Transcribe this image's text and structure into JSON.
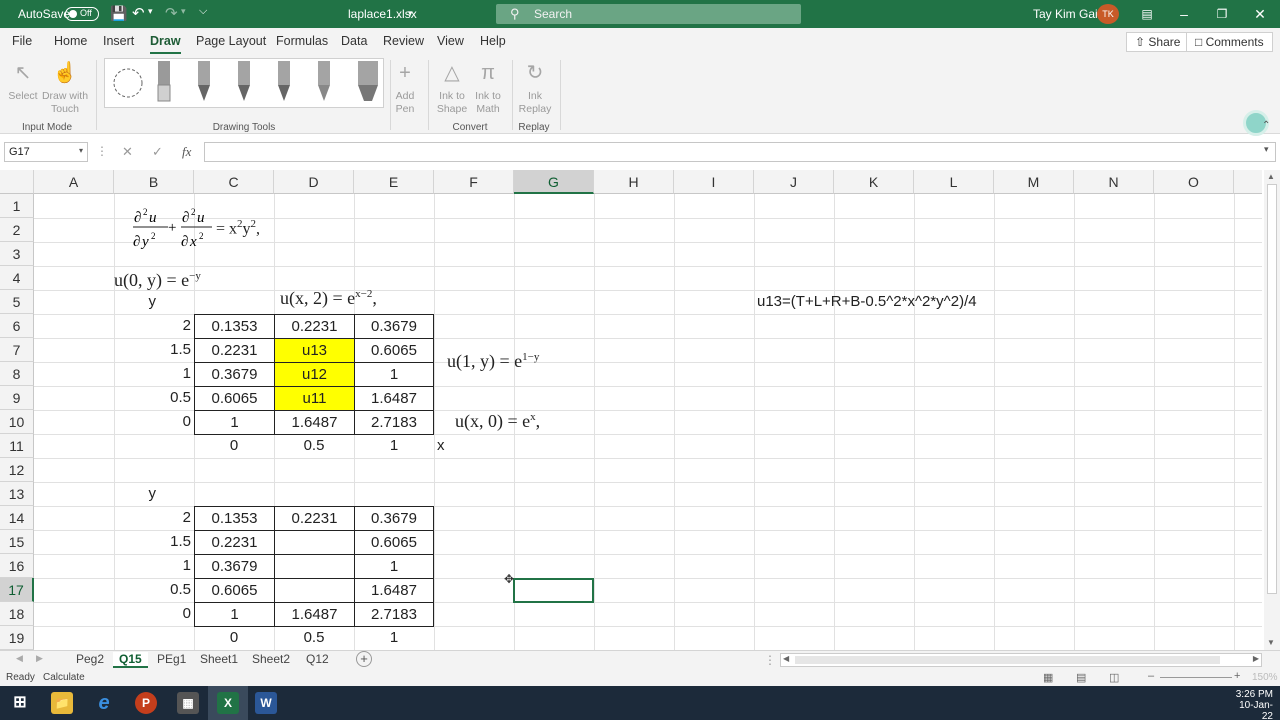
{
  "titlebar": {
    "autosave_label": "AutoSave",
    "autosave_state": "Off",
    "filename": "laplace1.xlsx",
    "search_placeholder": "Search",
    "user_name": "Tay Kim Gaik",
    "user_initials": "TK"
  },
  "tabs": [
    "File",
    "Home",
    "Insert",
    "Draw",
    "Page Layout",
    "Formulas",
    "Data",
    "Review",
    "View",
    "Help"
  ],
  "active_tab": "Draw",
  "share_label": "Share",
  "comments_label": "Comments",
  "ribbon": {
    "select_label": "Select",
    "draw_touch_label_1": "Draw with",
    "draw_touch_label_2": "Touch",
    "input_mode_label": "Input Mode",
    "drawing_tools_label": "Drawing Tools",
    "add_pen_label_1": "Add",
    "add_pen_label_2": "Pen",
    "ink_shape_label_1": "Ink to",
    "ink_shape_label_2": "Shape",
    "ink_math_label_1": "Ink to",
    "ink_math_label_2": "Math",
    "ink_replay_label_1": "Ink",
    "ink_replay_label_2": "Replay",
    "convert_label": "Convert",
    "replay_label": "Replay"
  },
  "namebox": "G17",
  "formula_symbol": "fx",
  "columns": [
    "A",
    "B",
    "C",
    "D",
    "E",
    "F",
    "G",
    "H",
    "I",
    "J",
    "K",
    "L",
    "M",
    "N",
    "O"
  ],
  "selected_column": "G",
  "rows": [
    "1",
    "2",
    "3",
    "4",
    "5",
    "6",
    "7",
    "8",
    "9",
    "10",
    "11",
    "12",
    "13",
    "14",
    "15",
    "16",
    "17",
    "18",
    "19"
  ],
  "selected_row": "17",
  "cells": {
    "B5": "y",
    "B6": "2",
    "C6": "0.1353",
    "D6": "0.2231",
    "E6": "0.3679",
    "B7": "1.5",
    "C7": "0.2231",
    "D7": "u13",
    "E7": "0.6065",
    "B8": "1",
    "C8": "0.3679",
    "D8": "u12",
    "E8": "1",
    "B9": "0.5",
    "C9": "0.6065",
    "D9": "u11",
    "E9": "1.6487",
    "B10": "0",
    "C10": "1",
    "D10": "1.6487",
    "E10": "2.7183",
    "C11": "0",
    "D11": "0.5",
    "E11": "1",
    "F11": "x",
    "B13": "y",
    "B14": "2",
    "C14": "0.1353",
    "D14": "0.2231",
    "E14": "0.3679",
    "B15": "1.5",
    "C15": "0.2231",
    "E15": "0.6065",
    "B16": "1",
    "C16": "0.3679",
    "E16": "1",
    "B17": "0.5",
    "C17": "0.6065",
    "E17": "1.6487",
    "B18": "0",
    "C18": "1",
    "D18": "1.6487",
    "E18": "2.7183",
    "C19": "0",
    "D19": "0.5",
    "E19": "1",
    "J5": "u13=(T+L+R+B-0.5^2*x^2*y^2)/4"
  },
  "equations": {
    "pde_lhs": "∂²u/∂y² + ∂²u/∂x²",
    "pde_rhs": "= x",
    "pde_rhs_exp1": "2",
    "pde_rhs_mid": "y",
    "pde_rhs_exp2": "2",
    "pde_tail": ",",
    "left_bc": "u(0, y) = e",
    "left_bc_exp": "−y",
    "top_bc": "u(x, 2) = e",
    "top_bc_exp": "x−2",
    "top_bc_tail": ",",
    "right_bc": "u(1, y) = e",
    "right_bc_exp": "1−y",
    "bottom_bc": "u(x, 0) = e",
    "bottom_bc_exp": "x",
    "bottom_bc_tail": ","
  },
  "sheets": [
    "Peg2",
    "Q15",
    "PEg1",
    "Sheet1",
    "Sheet2",
    "Q12"
  ],
  "active_sheet": "Q15",
  "status": {
    "ready": "Ready",
    "calculate": "Calculate",
    "zoom": "150%"
  },
  "taskbar": {
    "time": "3:26 PM",
    "date": "10-Jan-22"
  }
}
